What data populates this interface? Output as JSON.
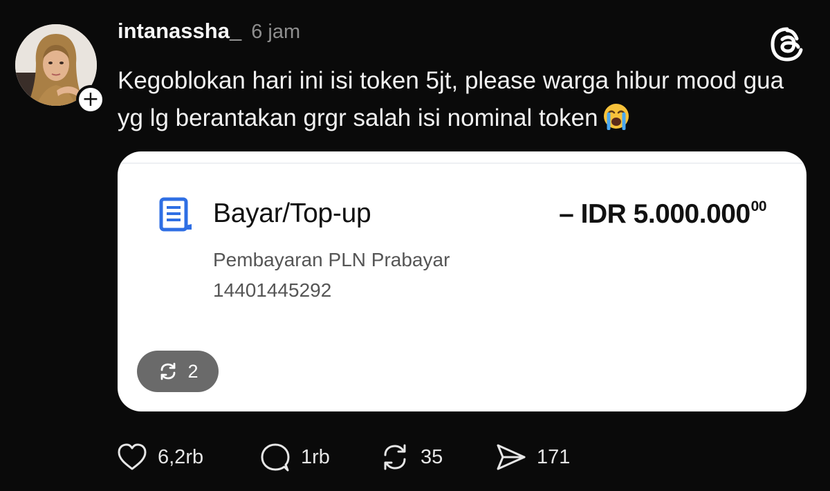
{
  "post": {
    "username": "intanassha_",
    "time": "6 jam",
    "text": "Kegoblokan hari ini isi token 5jt, please warga hibur mood gua yg lg berantakan grgr salah isi nominal token",
    "emoji": "loudly-crying-face"
  },
  "card": {
    "title": "Bayar/Top-up",
    "amount": "– IDR 5.000.000",
    "amount_decimals": "00",
    "subtitle": "Pembayaran PLN Prabayar",
    "account_id": "14401445292",
    "repost_count": "2"
  },
  "actions": {
    "likes": "6,2rb",
    "replies": "1rb",
    "reposts": "35",
    "shares": "171"
  },
  "colors": {
    "background": "#0a0a0a",
    "card_background": "#ffffff",
    "accent_blue": "#2f6fe4",
    "muted_text": "#8e8e8e"
  }
}
